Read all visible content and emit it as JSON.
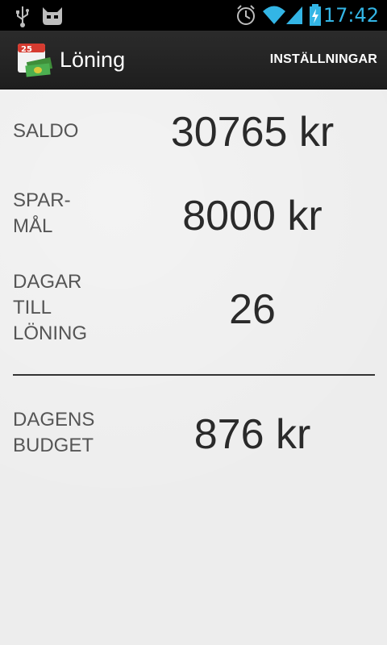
{
  "status_bar": {
    "time": "17:42",
    "icons": [
      "usb-icon",
      "cyanogen-cat-icon",
      "alarm-icon",
      "wifi-icon",
      "signal-icon",
      "battery-charging-icon"
    ],
    "accent_color": "#33b5e5"
  },
  "action_bar": {
    "app_icon": "calendar-money-icon",
    "app_icon_day": "25",
    "title": "Löning",
    "settings_label": "INSTÄLLNINGAR"
  },
  "rows": [
    {
      "label": "SALDO",
      "value": "30765 kr"
    },
    {
      "label": "SPAR-\nMÅL",
      "value": "8000 kr"
    },
    {
      "label": "DAGAR\nTILL\nLÖNING",
      "value": "26"
    },
    {
      "label": "DAGENS\nBUDGET",
      "value": "876 kr"
    }
  ]
}
